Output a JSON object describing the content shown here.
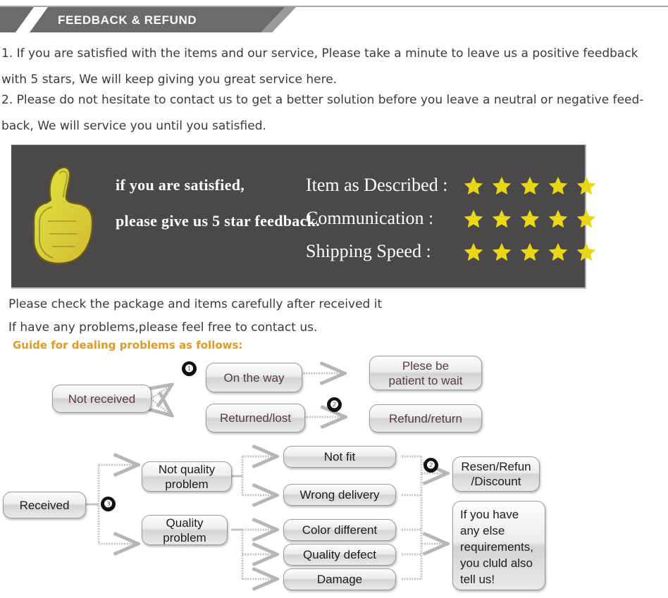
{
  "header": {
    "banner_title": "FEEDBACK & REFUND"
  },
  "paragraphs": {
    "p1": "1. If you are satisfied with the items and our service, Please take a minute to leave us a positive feedback with 5 stars, We will keep giving you great service here.",
    "p2": "2. Please do not hesitate to contact us to get a better solution before you leave a neutral or negative feed-back, We will service you until you satisfied."
  },
  "feedback_block": {
    "thumb_icon": "thumbs-up-icon",
    "line1": "if you are satisfied,",
    "line2": "please give us 5 star feedback.",
    "ratings": [
      {
        "label": "Item as Described :",
        "stars": 5
      },
      {
        "label": "Communication :",
        "stars": 5
      },
      {
        "label": "Shipping Speed :",
        "stars": 5
      }
    ],
    "star_color": "#e8d617",
    "background_color": "#4a4848"
  },
  "notes": {
    "note1": "Please check the package and items carefully after received it",
    "note2": "If have any problems,please feel free to contact us.",
    "guide": "Guide for dealing problems as follows:",
    "guide_color": "#e09a25"
  },
  "flow1": {
    "start": "Not received",
    "badge1": "❶",
    "badge2": "❷",
    "branch_top": "On the way",
    "branch_bottom": "Returned/lost",
    "result_top": "Plese be\npatient to wait",
    "result_bottom": "Refund/return"
  },
  "flow2": {
    "start": "Received",
    "badge3": "❸",
    "badge2": "❷",
    "cat_top": "Not quality\nproblem",
    "cat_bottom": "Quality\nproblem",
    "items": [
      "Not fit",
      "Wrong delivery",
      "Color different",
      "Quality defect",
      "Damage"
    ],
    "result_top": "Resen/Refun\n/Discount",
    "result_bottom": "If you have\nany else\nrequirements,\nyou cluld also\ntell us!"
  }
}
